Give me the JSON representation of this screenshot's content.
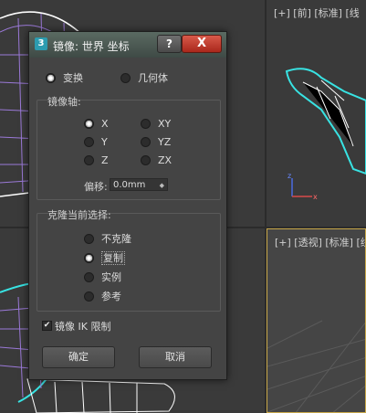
{
  "viewports": {
    "front_label": "[+] [前] [标准] [线",
    "perspective_label": "[+] [透视] [标准] [线"
  },
  "dialog": {
    "icon_text": "3",
    "title": "镜像: 世界 坐标",
    "help_label": "?",
    "close_label": "X",
    "mode_options": [
      "变换",
      "几何体"
    ],
    "mode_selected": "变换",
    "axis_group_title": "镜像轴:",
    "axes": [
      "X",
      "XY",
      "Y",
      "YZ",
      "Z",
      "ZX"
    ],
    "axis_selected": "X",
    "offset_label": "偏移:",
    "offset_value": "0.0mm",
    "clone_group_title": "克隆当前选择:",
    "clone_options": [
      "不克隆",
      "复制",
      "实例",
      "参考"
    ],
    "clone_selected": "复制",
    "ik_label": "镜像 IK 限制",
    "ik_checked": true,
    "ok_label": "确定",
    "cancel_label": "取消"
  },
  "colors": {
    "viewport_bg": "#3a3a3a",
    "wire_white": "#ffffff",
    "wire_purple": "#9b79d8",
    "wire_cyan": "#38e3e3",
    "active_border": "#c8a84a"
  },
  "icons": [
    "spinner-arrows-icon",
    "checkmark-icon",
    "axis-tripod-icon"
  ]
}
